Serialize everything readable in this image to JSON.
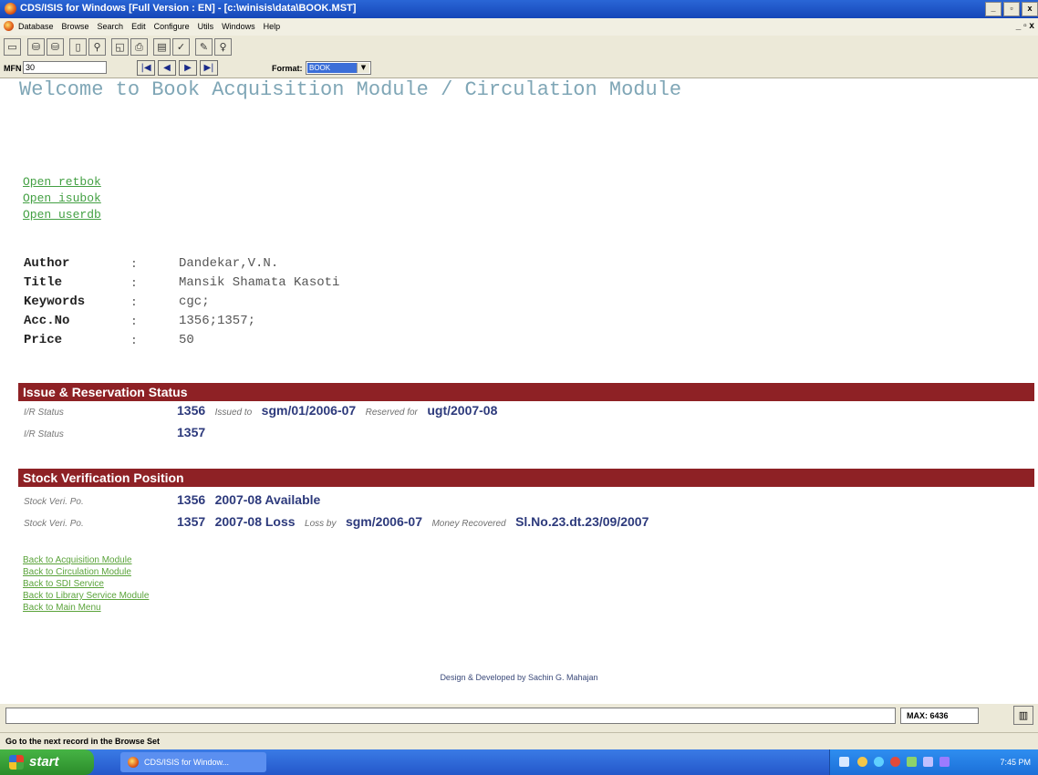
{
  "window": {
    "title": "CDS/ISIS for Windows [Full Version : EN] - [c:\\winisis\\data\\BOOK.MST]",
    "controls": {
      "minimize": "_",
      "maximize": "▫",
      "close": "x"
    }
  },
  "menubar": {
    "items": [
      "Database",
      "Browse",
      "Search",
      "Edit",
      "Configure",
      "Utils",
      "Windows",
      "Help"
    ],
    "mdi_controls": "_ ▫ x"
  },
  "toolbar": {
    "icons": [
      "open-folder-icon",
      "database-icon",
      "database-alt-icon",
      "document-icon",
      "search-docs-icon",
      "print-preview-icon",
      "print-icon",
      "form-icon",
      "check-icon",
      "pencil-icon",
      "lightbulb-icon"
    ]
  },
  "navbar": {
    "mfn_label": "MFN",
    "mfn_value": "30",
    "buttons": {
      "first": "|◀",
      "prev": "◀",
      "next": "▶",
      "last": "▶|"
    },
    "format_label": "Format:",
    "format_value": "BOOK"
  },
  "content": {
    "welcome": "Welcome to Book Acquisition Module / Circulation Module",
    "open_links": [
      "Open retbok",
      "Open isubok",
      "Open userdb"
    ],
    "fields": [
      {
        "label": "Author",
        "value": "Dandekar,V.N."
      },
      {
        "label": "Title",
        "value": "Mansik Shamata Kasoti"
      },
      {
        "label": "Keywords",
        "value": "cgc;"
      },
      {
        "label": "Acc.No",
        "value": "1356;1357;"
      },
      {
        "label": "Price",
        "value": "50"
      }
    ],
    "colon": ":",
    "issue_section": {
      "header": "Issue & Reservation Status",
      "rows": [
        {
          "label": "I/R Status",
          "acc": "1356",
          "issued_label": "Issued to",
          "issued_value": "sgm/01/2006-07",
          "reserved_label": "Reserved for",
          "reserved_value": "ugt/2007-08"
        },
        {
          "label": "I/R Status",
          "acc": "1357"
        }
      ]
    },
    "stock_section": {
      "header": "Stock Verification Position",
      "rows": [
        {
          "label": "Stock Veri. Po.",
          "acc": "1356",
          "status": "2007-08 Available"
        },
        {
          "label": "Stock Veri. Po.",
          "acc": "1357",
          "status": "2007-08 Loss",
          "loss_label": "Loss by",
          "loss_value": "sgm/2006-07",
          "money_label": "Money Recovered",
          "money_value": "Sl.No.23.dt.23/09/2007"
        }
      ]
    },
    "back_links": [
      "Back to Acquisition Module",
      "Back to Circulation Module",
      "Back to SDI Service",
      "Back to Library Service Module",
      "Back to Main Menu"
    ],
    "credit": "Design & Developed by Sachin G. Mahajan"
  },
  "status": {
    "max_label": "MAX: 6436",
    "hint": "Go to the next record in the Browse Set"
  },
  "taskbar": {
    "start_label": "start",
    "task_label": "CDS/ISIS for Window...",
    "clock": "7:45 PM"
  },
  "colors": {
    "accent_header": "#8e2125",
    "link_green": "#43a043",
    "value_blue": "#2d3a7c",
    "welcome_blue": "#7fa6b6"
  }
}
